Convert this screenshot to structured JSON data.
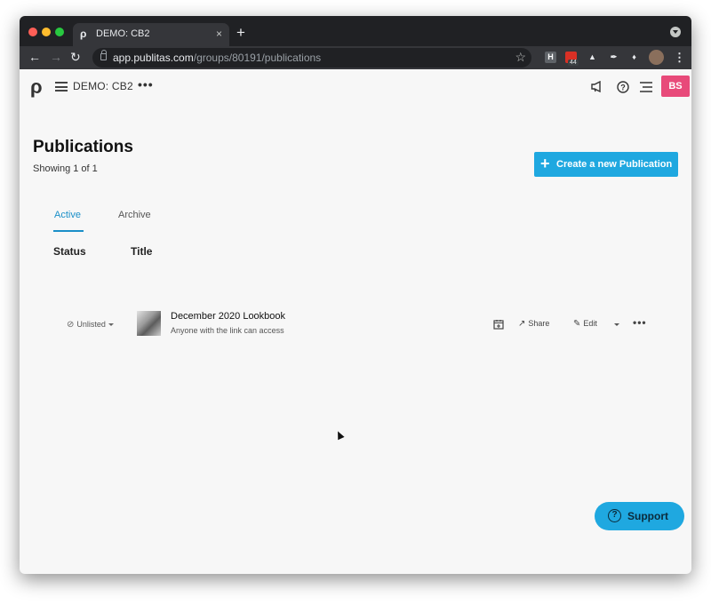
{
  "browser": {
    "tab_title": "DEMO: CB2",
    "tab_favicon": "ρ",
    "tab_close": "×",
    "new_tab": "+",
    "url_host": "app.publitas.com",
    "url_path": "/groups/80191/publications",
    "extension_badge": "44"
  },
  "app": {
    "logo": "ρ",
    "workspace_name": "DEMO: CB2",
    "more": "•••",
    "avatar_initials": "BS",
    "accent_color": "#1fa8e0",
    "avatar_color": "#e84a7a"
  },
  "main": {
    "title": "Publications",
    "showing": "Showing 1 of 1",
    "create_button": "Create a new Publication",
    "tabs": [
      {
        "label": "Active",
        "active": true
      },
      {
        "label": "Archive",
        "active": false
      }
    ],
    "columns": [
      "Status",
      "Title"
    ]
  },
  "publications": [
    {
      "status": "Unlisted",
      "title": "December 2020 Lookbook",
      "subtitle": "Anyone with the link can access",
      "share_label": "Share",
      "edit_label": "Edit",
      "more": "•••"
    }
  ],
  "support": {
    "label": "Support",
    "icon": "?"
  }
}
